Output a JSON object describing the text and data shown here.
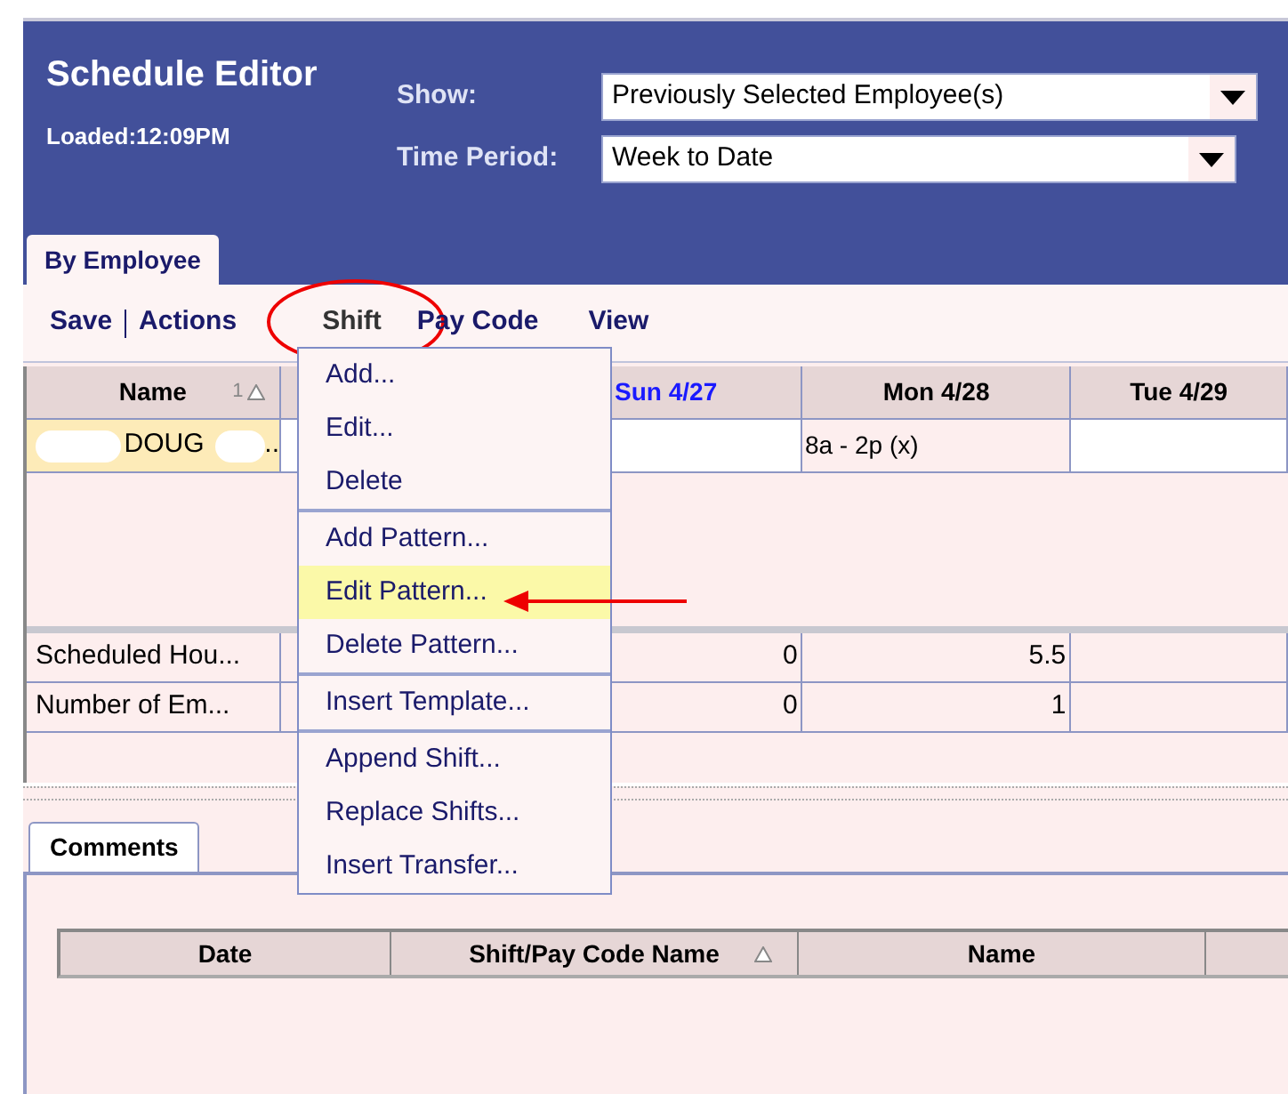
{
  "header": {
    "title": "Schedule Editor",
    "loaded": "Loaded:12:09PM",
    "filters": [
      {
        "label": "Show:",
        "value": "Previously Selected Employee(s)"
      },
      {
        "label": "Time Period:",
        "value": "Week to Date"
      }
    ]
  },
  "tabs": [
    {
      "label": "By Employee",
      "selected": true
    }
  ],
  "toolbar": [
    {
      "label": "Save",
      "separator_after": true,
      "circled": false
    },
    {
      "label": "Actions",
      "separator_after": false,
      "circled": false
    },
    {
      "label": "Shift",
      "separator_after": false,
      "circled": true
    },
    {
      "label": "Pay Code",
      "separator_after": false,
      "circled": false
    },
    {
      "label": "View",
      "separator_after": false,
      "circled": false
    }
  ],
  "grid": {
    "columns": [
      {
        "label": "Name",
        "sort": "1",
        "sort_arrow": true,
        "highlighted": false
      },
      {
        "label": "Sun 4/27",
        "highlighted": true
      },
      {
        "label": "Mon 4/28",
        "highlighted": false
      },
      {
        "label": "Tue 4/29",
        "highlighted": false
      }
    ],
    "rows": [
      {
        "name": "DOUG",
        "suffix": "..",
        "selected": true,
        "cells": [
          "",
          "8a - 2p (x)",
          ""
        ]
      }
    ],
    "summary": [
      {
        "label": "Scheduled Hou...",
        "cells": [
          "0",
          "5.5",
          ""
        ]
      },
      {
        "label": "Number of Em...",
        "cells": [
          "0",
          "1",
          ""
        ]
      }
    ]
  },
  "menu": {
    "groups": [
      [
        {
          "label": "Add...",
          "selected": false
        },
        {
          "label": "Edit...",
          "selected": false
        },
        {
          "label": "Delete",
          "selected": false
        }
      ],
      [
        {
          "label": "Add Pattern...",
          "selected": false
        },
        {
          "label": "Edit Pattern...",
          "selected": true
        },
        {
          "label": "Delete Pattern...",
          "selected": false
        }
      ],
      [
        {
          "label": "Insert Template...",
          "selected": false
        }
      ],
      [
        {
          "label": "Append Shift...",
          "selected": false
        },
        {
          "label": "Replace Shifts...",
          "selected": false
        },
        {
          "label": "Insert Transfer...",
          "selected": false
        }
      ]
    ]
  },
  "comments": {
    "tab": {
      "label": "Comments",
      "selected": true
    },
    "columns": [
      {
        "label": "Date",
        "sorted": false
      },
      {
        "label": "Shift/Pay Code Name",
        "sorted": true
      },
      {
        "label": "Name",
        "sorted": false
      }
    ]
  }
}
